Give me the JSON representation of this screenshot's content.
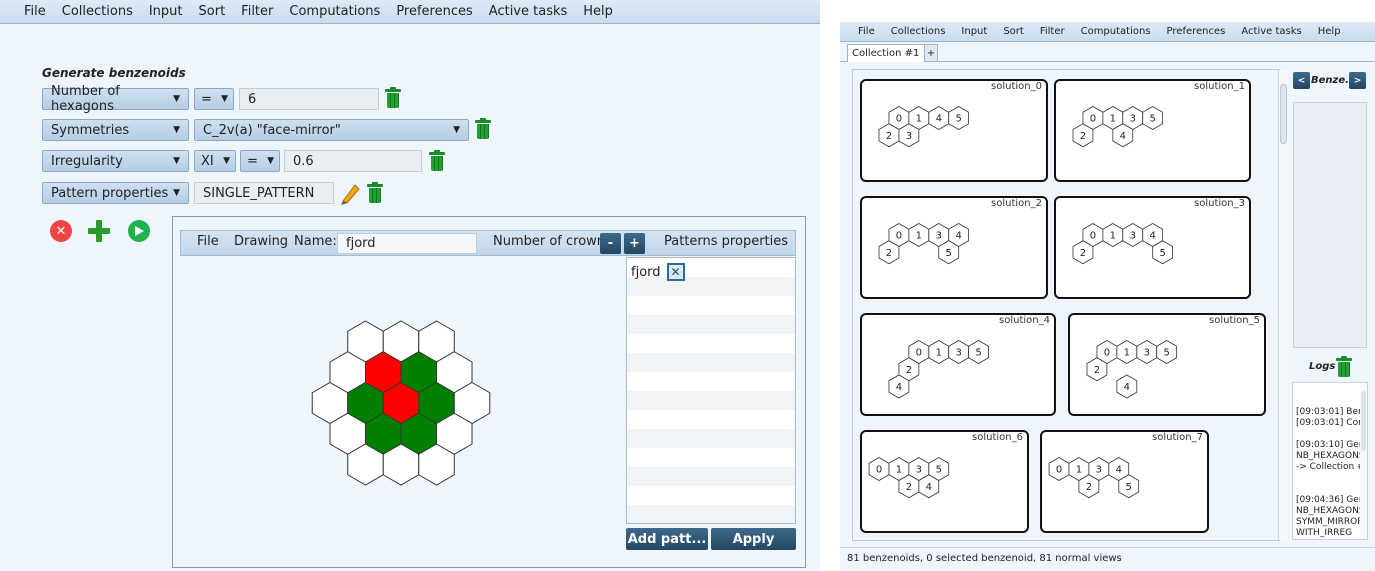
{
  "left": {
    "menu": [
      "File",
      "Collections",
      "Input",
      "Sort",
      "Filter",
      "Computations",
      "Preferences",
      "Active tasks",
      "Help"
    ],
    "section_title": "Generate benzenoids",
    "criteria": [
      {
        "name": "Number of hexagons",
        "op": "=",
        "value": "6"
      },
      {
        "name": "Symmetries",
        "value": "C_2v(a) \"face-mirror\""
      },
      {
        "name": "Irregularity",
        "sub": "XI",
        "op": "=",
        "value": "0.6"
      },
      {
        "name": "Pattern properties",
        "value": "SINGLE_PATTERN"
      }
    ],
    "pattern": {
      "menu": [
        "File",
        "Drawing"
      ],
      "name_label": "Name:",
      "name_value": "fjord",
      "crowns_label": "Number of crowns:",
      "minus": "-",
      "plus": "+",
      "props_title": "Patterns properties",
      "props_items": [
        "fjord"
      ],
      "add_button": "Add patt...",
      "apply_button": "Apply",
      "cell_states": [
        "white",
        "white",
        "white",
        "white",
        "red",
        "green",
        "white",
        "white",
        "green",
        "red",
        "green",
        "white",
        "white",
        "green",
        "green",
        "white",
        "white",
        "white",
        "white"
      ],
      "colors": {
        "red": "#ff0000",
        "green": "#008000",
        "white": "#ffffff"
      }
    }
  },
  "right": {
    "menu": [
      "File",
      "Collections",
      "Input",
      "Sort",
      "Filter",
      "Computations",
      "Preferences",
      "Active tasks",
      "Help"
    ],
    "tab_label": "Collection #1",
    "tab_close": "×",
    "tab_add": "+",
    "nav_label": "Benze...",
    "nav_prev": "<",
    "nav_next": ">",
    "logs_label": "Logs",
    "logs": [
      "[09:03:01] Ben",
      "[09:03:01] Cor",
      "",
      "[09:03:10] Ger",
      "NB_HEXAGONS",
      "-> Collection #",
      "",
      "",
      "[09:04:36] Ger",
      "NB_HEXAGONS",
      "SYMM_MIRROR",
      "WITH_IRREG"
    ],
    "solutions": [
      {
        "title": "solution_0",
        "hexes": [
          [
            "0",
            1,
            0
          ],
          [
            "1",
            2,
            0
          ],
          [
            "4",
            3,
            0
          ],
          [
            "5",
            4,
            0
          ],
          [
            "2",
            0,
            1
          ],
          [
            "3",
            1,
            1
          ]
        ]
      },
      {
        "title": "solution_1",
        "hexes": [
          [
            "0",
            1,
            0
          ],
          [
            "1",
            2,
            0
          ],
          [
            "3",
            3,
            0
          ],
          [
            "5",
            4,
            0
          ],
          [
            "2",
            0,
            1
          ],
          [
            "4",
            2,
            1
          ]
        ]
      },
      {
        "title": "solution_2",
        "hexes": [
          [
            "0",
            1,
            0
          ],
          [
            "1",
            2,
            0
          ],
          [
            "3",
            3,
            0
          ],
          [
            "4",
            4,
            0
          ],
          [
            "2",
            0,
            1
          ],
          [
            "5",
            3,
            1
          ]
        ]
      },
      {
        "title": "solution_3",
        "hexes": [
          [
            "0",
            1,
            0
          ],
          [
            "1",
            2,
            0
          ],
          [
            "3",
            3,
            0
          ],
          [
            "4",
            4,
            0
          ],
          [
            "2",
            0,
            1
          ],
          [
            "5",
            4,
            1
          ]
        ]
      },
      {
        "title": "solution_4",
        "hexes": [
          [
            "0",
            2,
            0
          ],
          [
            "1",
            3,
            0
          ],
          [
            "3",
            4,
            0
          ],
          [
            "5",
            5,
            0
          ],
          [
            "2",
            1,
            1
          ],
          [
            "4",
            0,
            2
          ]
        ]
      },
      {
        "title": "solution_5",
        "hexes": [
          [
            "0",
            1,
            0
          ],
          [
            "1",
            2,
            0
          ],
          [
            "3",
            3,
            0
          ],
          [
            "5",
            4,
            0
          ],
          [
            "2",
            0,
            1
          ],
          [
            "4",
            1,
            2
          ]
        ]
      },
      {
        "title": "solution_6",
        "hexes": [
          [
            "0",
            0,
            0
          ],
          [
            "1",
            1,
            0
          ],
          [
            "3",
            2,
            0
          ],
          [
            "5",
            3,
            0
          ],
          [
            "2",
            1,
            1
          ],
          [
            "4",
            2,
            1
          ]
        ]
      },
      {
        "title": "solution_7",
        "hexes": [
          [
            "0",
            0,
            0
          ],
          [
            "1",
            1,
            0
          ],
          [
            "3",
            2,
            0
          ],
          [
            "4",
            3,
            0
          ],
          [
            "2",
            1,
            1
          ],
          [
            "5",
            3,
            1
          ]
        ]
      }
    ],
    "status": "81 benzenoids, 0 selected benzenoid, 81 normal views"
  }
}
